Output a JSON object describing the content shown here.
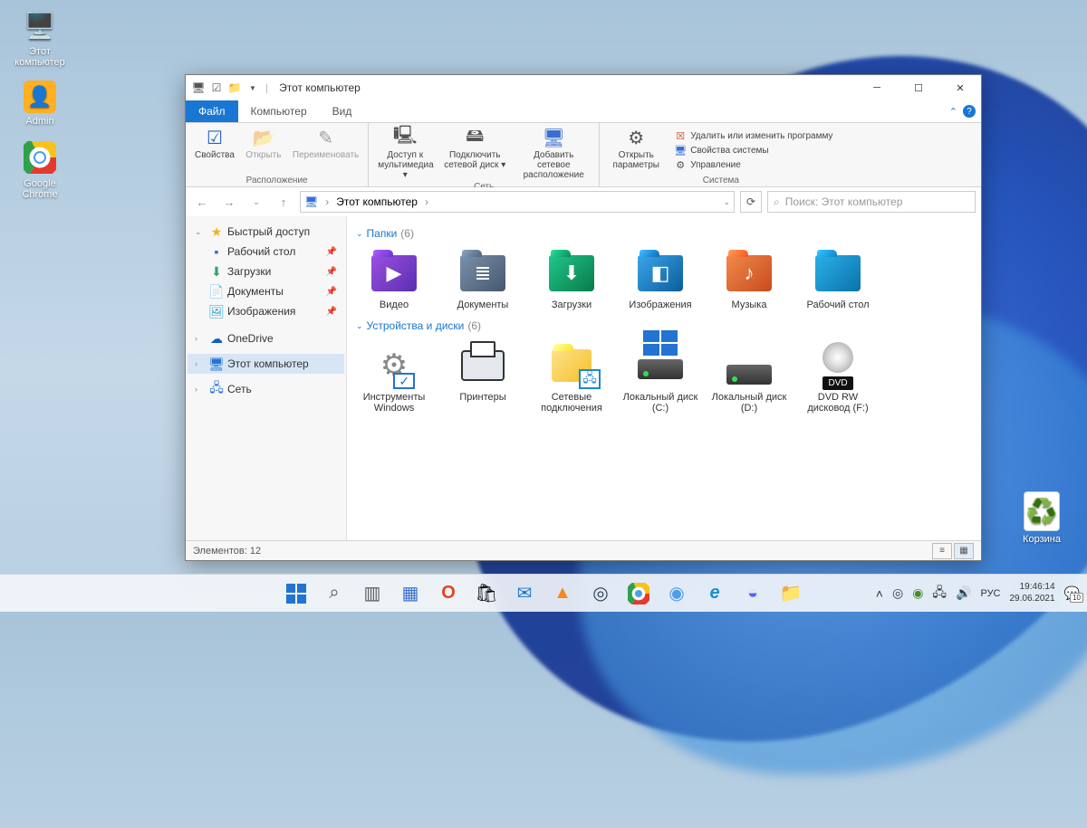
{
  "desktop_icons": [
    {
      "name": "this-pc",
      "label": "Этот компьютер",
      "glyph": "🖥️",
      "color": "#3aa0ff"
    },
    {
      "name": "admin",
      "label": "Admin",
      "glyph": "👤",
      "color": "#ffb020"
    },
    {
      "name": "chrome",
      "label": "Google Chrome",
      "glyph": "◉",
      "color": "#ffd24a"
    }
  ],
  "recycle": {
    "label": "Корзина",
    "glyph": "♻️"
  },
  "window": {
    "title": "Этот компьютер",
    "tabs": [
      {
        "k": "file",
        "label": "Файл",
        "active": true
      },
      {
        "k": "computer",
        "label": "Компьютер"
      },
      {
        "k": "view",
        "label": "Вид"
      }
    ],
    "ribbon": {
      "groups": [
        {
          "label": "Расположение",
          "items": [
            {
              "k": "props",
              "label": "Свойства",
              "glyph": "☑"
            },
            {
              "k": "open",
              "label": "Открыть",
              "glyph": "📂"
            },
            {
              "k": "rename",
              "label": "Переименовать",
              "glyph": "✎"
            }
          ]
        },
        {
          "label": "Сеть",
          "items": [
            {
              "k": "media",
              "label": "Доступ к мультимедиа ▾",
              "glyph": "🖳"
            },
            {
              "k": "mapdrive",
              "label": "Подключить сетевой диск ▾",
              "glyph": "🖴"
            },
            {
              "k": "addnet",
              "label": "Добавить сетевое расположение",
              "glyph": "🖥"
            }
          ]
        },
        {
          "label": "Система",
          "main": {
            "k": "settings",
            "label": "Открыть параметры",
            "glyph": "⚙"
          },
          "items": [
            {
              "k": "uninstall",
              "label": "Удалить или изменить программу",
              "glyph": "🗑"
            },
            {
              "k": "sysprops",
              "label": "Свойства системы",
              "glyph": "🖥"
            },
            {
              "k": "manage",
              "label": "Управление",
              "glyph": "⚙"
            }
          ]
        }
      ]
    },
    "breadcrumb": {
      "label": "Этот компьютер"
    },
    "search_placeholder": "Поиск: Этот компьютер",
    "sidebar": {
      "quick": {
        "label": "Быстрый доступ",
        "items": [
          {
            "k": "desktop",
            "label": "Рабочий стол",
            "glyph": "🖥",
            "color": "#2373d2"
          },
          {
            "k": "downloads",
            "label": "Загрузки",
            "glyph": "⬇",
            "color": "#2aa76a"
          },
          {
            "k": "documents",
            "label": "Документы",
            "glyph": "📄",
            "color": "#6f7f94"
          },
          {
            "k": "pictures",
            "label": "Изображения",
            "glyph": "🖼",
            "color": "#2aa7d2"
          }
        ]
      },
      "onedrive": {
        "label": "OneDrive",
        "glyph": "☁",
        "color": "#0a60c2"
      },
      "thispc": {
        "label": "Этот компьютер",
        "glyph": "🖥",
        "color": "#2373d2"
      },
      "network": {
        "label": "Сеть",
        "glyph": "🌐",
        "color": "#2373d2"
      }
    },
    "groups": [
      {
        "title": "Папки",
        "count": "(6)",
        "items": [
          {
            "k": "videos",
            "label": "Видео",
            "color": "#7a3fcf",
            "glyph": "▶"
          },
          {
            "k": "documents",
            "label": "Документы",
            "color": "#5e7590",
            "glyph": "≣"
          },
          {
            "k": "downloads",
            "label": "Загрузки",
            "color": "#0fa66a",
            "glyph": "⬇"
          },
          {
            "k": "pictures",
            "label": "Изображения",
            "color": "#1f86d0",
            "glyph": "◧"
          },
          {
            "k": "music",
            "label": "Музыка",
            "color": "#e0683a",
            "glyph": "♪"
          },
          {
            "k": "desktop",
            "label": "Рабочий стол",
            "color": "#1aa0db",
            "glyph": ""
          }
        ]
      },
      {
        "title": "Устройства и диски",
        "count": "(6)",
        "items": [
          {
            "k": "wintools",
            "label": "Инструменты Windows",
            "type": "tools"
          },
          {
            "k": "printers",
            "label": "Принтеры",
            "type": "printer"
          },
          {
            "k": "netconn",
            "label": "Сетевые подключения",
            "type": "net"
          },
          {
            "k": "diskc",
            "label": "Локальный диск (C:)",
            "type": "disk-win"
          },
          {
            "k": "diskd",
            "label": "Локальный диск (D:)",
            "type": "disk"
          },
          {
            "k": "dvdf",
            "label": "DVD RW дисковод (F:)",
            "type": "dvd",
            "badge": "DVD"
          }
        ]
      }
    ],
    "status": {
      "label": "Элементов: 12"
    }
  },
  "taskbar": {
    "apps": [
      {
        "k": "start",
        "type": "start"
      },
      {
        "k": "search",
        "glyph": "⌕",
        "color": "#555"
      },
      {
        "k": "taskview",
        "glyph": "▥",
        "color": "#555"
      },
      {
        "k": "widgets",
        "glyph": "▦",
        "color": "#3a6fd2"
      },
      {
        "k": "office",
        "glyph": "O",
        "color": "#e6431f"
      },
      {
        "k": "store",
        "glyph": "🛍",
        "color": "#333"
      },
      {
        "k": "mail",
        "glyph": "✉",
        "color": "#1976d2"
      },
      {
        "k": "vlc",
        "glyph": "▲",
        "color": "#f38b1e"
      },
      {
        "k": "steam",
        "glyph": "◎",
        "color": "#2d3d52"
      },
      {
        "k": "chrome",
        "glyph": "◉",
        "color": "#2fa14a"
      },
      {
        "k": "chromium",
        "glyph": "◉",
        "color": "#4a9fe8"
      },
      {
        "k": "edge",
        "glyph": "e",
        "color": "#1c8ad2"
      },
      {
        "k": "discord",
        "glyph": "◒",
        "color": "#5865f2"
      },
      {
        "k": "explorer",
        "glyph": "📁",
        "color": "#f3b84c"
      }
    ],
    "tray": [
      {
        "k": "overflow",
        "glyph": "^"
      },
      {
        "k": "steam-tray",
        "glyph": "◎",
        "color": "#2d3d52"
      },
      {
        "k": "nvidia",
        "glyph": "◉",
        "color": "#4a8a2a"
      },
      {
        "k": "network",
        "glyph": "🖧"
      },
      {
        "k": "sound",
        "glyph": "🔊"
      }
    ],
    "lang": "РУС",
    "time": "19:46:14",
    "date": "29.06.2021",
    "notif": {
      "glyph": "💬",
      "badge": "10"
    }
  }
}
